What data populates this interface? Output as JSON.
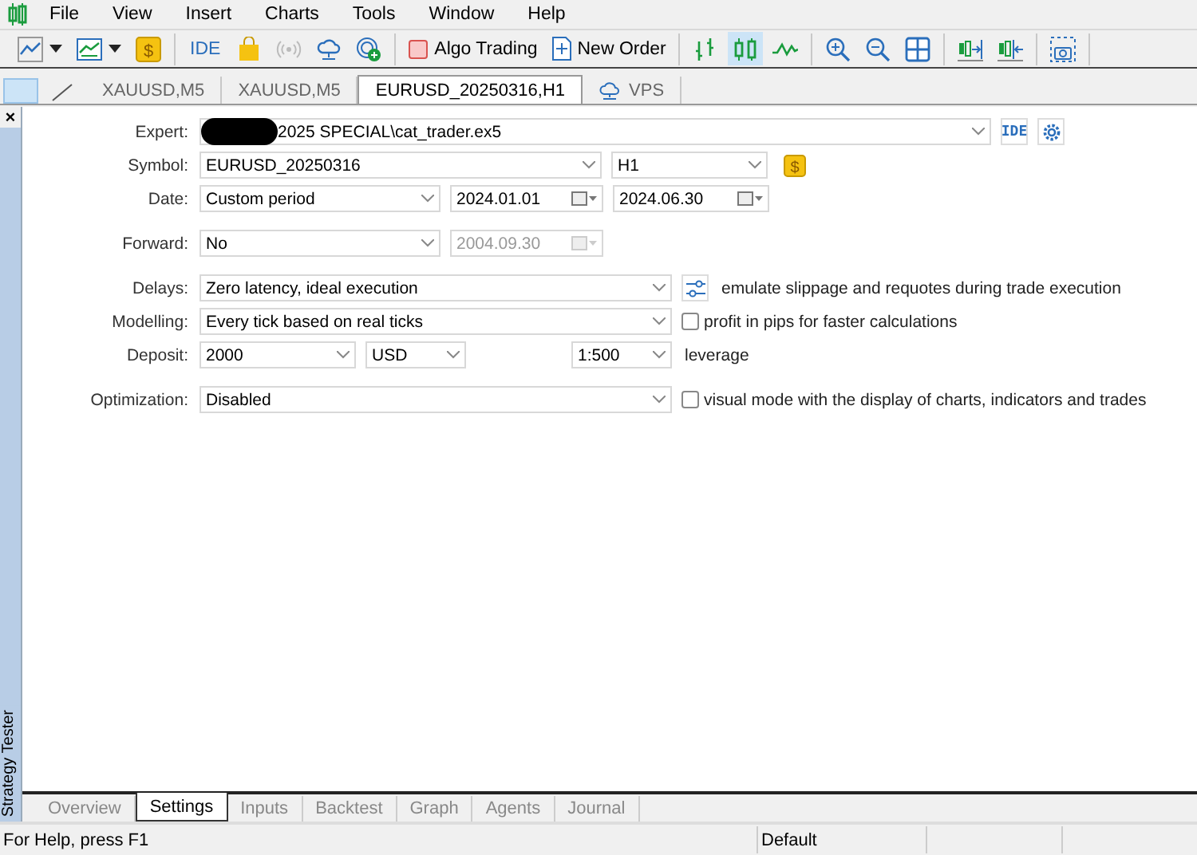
{
  "menu": [
    {
      "label": "File"
    },
    {
      "label": "View"
    },
    {
      "label": "Insert"
    },
    {
      "label": "Charts"
    },
    {
      "label": "Tools"
    },
    {
      "label": "Window"
    },
    {
      "label": "Help"
    }
  ],
  "toolbar": {
    "currency_symbol": "$",
    "ide_label": "IDE",
    "algo_trading": "Algo Trading",
    "new_order": "New Order",
    "chart_types": [
      {
        "selected": false
      },
      {
        "selected": true
      },
      {
        "selected": false
      }
    ]
  },
  "chart_tabs": [
    {
      "label": "XAUUSD,M5",
      "kind": "chart",
      "selected": false
    },
    {
      "label": "XAUUSD,M5",
      "kind": "chart",
      "selected": false
    },
    {
      "label": "EURUSD_20250316,H1",
      "kind": "chart",
      "selected": true
    },
    {
      "label": "VPS",
      "kind": "service",
      "selected": false
    }
  ],
  "tester": {
    "close": "×",
    "side_label": "Strategy Tester",
    "expert": {
      "label": "Expert:",
      "value": "2025 SPECIAL\\cat_trader.ex5",
      "ide_label": "IDE"
    },
    "symbol": {
      "label": "Symbol:",
      "value": "EURUSD_20250316",
      "period": "H1",
      "currency_symbol": "$"
    },
    "date": {
      "label": "Date:",
      "value": "Custom period",
      "from": "2024.01.01",
      "to": "2024.06.30"
    },
    "forward": {
      "label": "Forward:",
      "value": "No",
      "date": "2004.09.30",
      "disabled": true
    },
    "delays": {
      "label": "Delays:",
      "value": "Zero latency, ideal execution",
      "note": "emulate slippage and requotes during trade execution"
    },
    "modelling": {
      "label": "Modelling:",
      "value": "Every tick based on real ticks",
      "option": {
        "label": "profit in pips for faster calculations",
        "checked": false
      }
    },
    "deposit": {
      "label": "Deposit:",
      "value": "2000",
      "currency": "USD",
      "leverage_value": "1:500",
      "leverage_label": "leverage"
    },
    "optimization": {
      "label": "Optimization:",
      "value": "Disabled",
      "option": {
        "label": "visual mode with the display of charts, indicators and trades",
        "checked": false
      }
    },
    "tabs": [
      {
        "label": "Overview",
        "selected": false
      },
      {
        "label": "Settings",
        "selected": true
      },
      {
        "label": "Inputs",
        "selected": false
      },
      {
        "label": "Backtest",
        "selected": false
      },
      {
        "label": "Graph",
        "selected": false
      },
      {
        "label": "Agents",
        "selected": false
      },
      {
        "label": "Journal",
        "selected": false
      }
    ]
  },
  "status_bar": {
    "help": "For Help, press F1",
    "profile": "Default"
  }
}
